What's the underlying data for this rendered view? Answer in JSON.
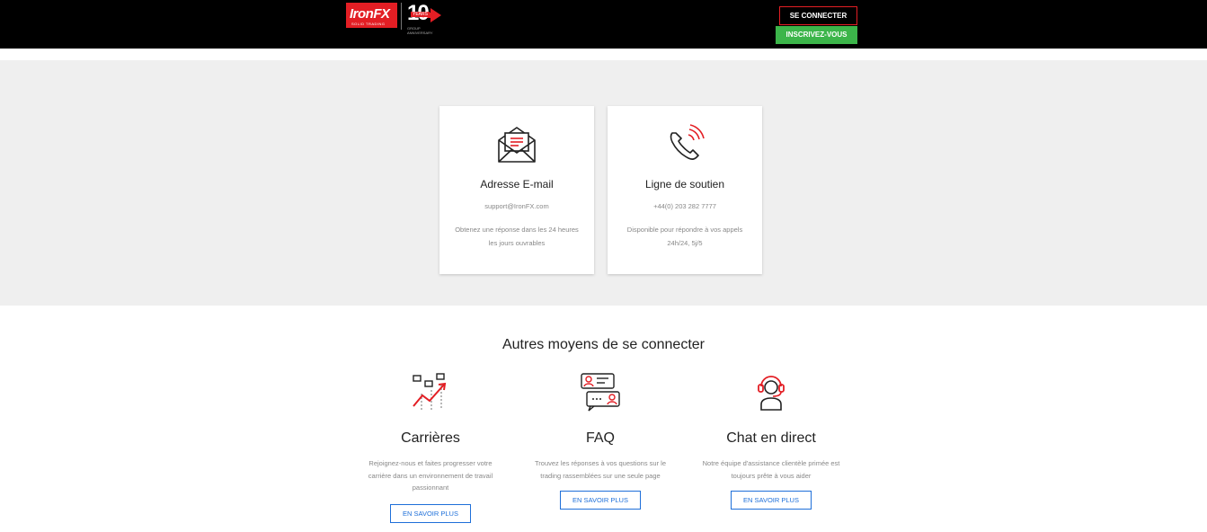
{
  "header": {
    "logo_text": "IronFX",
    "logo_sub": "SOLID TRADING",
    "anniversary_number": "10",
    "anniversary_tag": "YEARS",
    "anniversary_sub": "GROUP ANNIVERSARY",
    "login_label": "SE CONNECTER",
    "signup_label": "INSCRIVEZ-VOUS"
  },
  "contact": {
    "email": {
      "icon": "envelope-icon",
      "title": "Adresse E-mail",
      "value": "support@IronFX.com",
      "description": "Obtenez une réponse dans les 24 heures les jours ouvrables"
    },
    "phone": {
      "icon": "phone-icon",
      "title": "Ligne de soutien",
      "value": "+44(0) 203 282 7777",
      "description": "Disponible pour répondre à vos appels 24h/24, 5j/5"
    }
  },
  "other": {
    "title": "Autres moyens de se connecter",
    "items": [
      {
        "icon": "career-growth-icon",
        "title": "Carrières",
        "description": "Rejoignez-nous et faites progresser votre carrière dans un environnement de travail passionnant",
        "button": "EN SAVOIR PLUS"
      },
      {
        "icon": "faq-chat-icon",
        "title": "FAQ",
        "description": "Trouvez les réponses à vos questions sur le trading rassemblées sur une seule page",
        "button": "EN SAVOIR PLUS"
      },
      {
        "icon": "headset-agent-icon",
        "title": "Chat en direct",
        "description": "Notre équipe d'assistance clientèle primée est toujours prête à vous aider",
        "button": "EN SAVOIR PLUS"
      }
    ]
  },
  "colors": {
    "brand_red": "#e31e24",
    "signup_green": "#3cb54a",
    "link_blue": "#1e6fd9"
  }
}
